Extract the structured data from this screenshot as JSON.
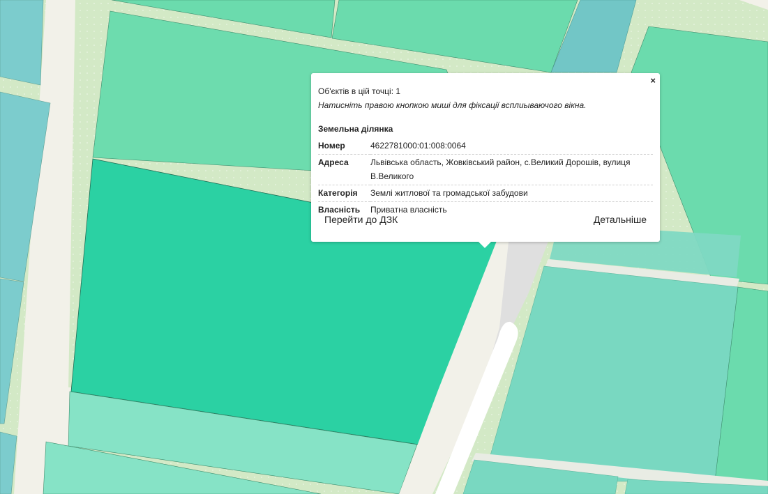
{
  "popup": {
    "close_symbol": "×",
    "objects_count_text": "Об'єктів в цій точці: 1",
    "hint_text": "Натисніть правою кнопкою миші для фіксації всплиываючого вікна.",
    "section_title": "Земельна ділянка",
    "properties": [
      {
        "key": "Номер",
        "value": "4622781000:01:008:0064"
      },
      {
        "key": "Адреса",
        "value": "Львівська область, Жовківський район, с.Великий Дорошів, вулиця В.Великого"
      },
      {
        "key": "Категорія",
        "value": "Землі житлової та громадської забудови"
      },
      {
        "key": "Власність",
        "value": "Приватна власність"
      }
    ],
    "actions": {
      "go_to_dzk": "Перейти до ДЗК",
      "details": "Детальніше"
    }
  },
  "colors": {
    "parcel_selected": "#2bd1a3",
    "parcel_default": "#6ddcae",
    "parcel_light": "#82e2c4",
    "parcel_teal": "#79c9cc",
    "road": "#f3f1e8",
    "background_green": "#cfe7c0"
  }
}
